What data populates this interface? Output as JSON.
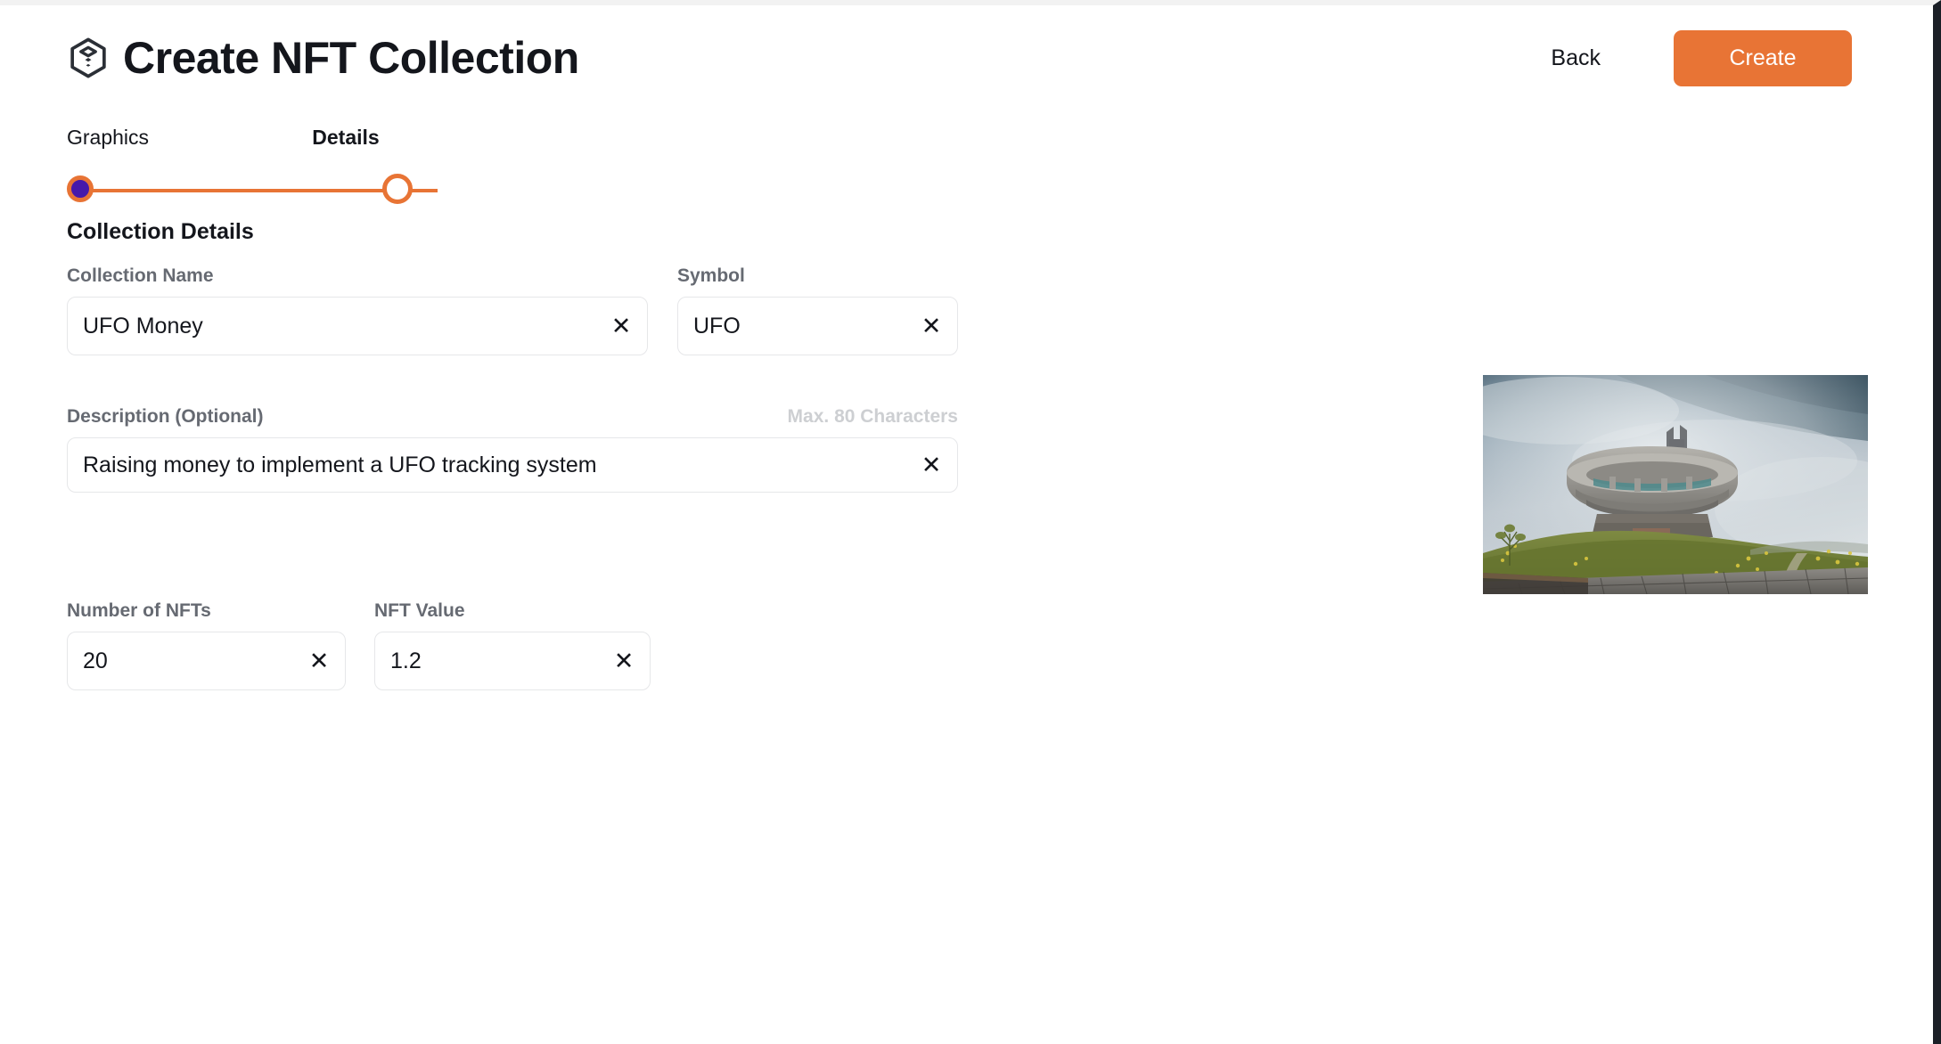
{
  "header": {
    "title": "Create NFT Collection",
    "brand_icon": "cube-hexagon-icon",
    "back_label": "Back",
    "create_label": "Create"
  },
  "stepper": {
    "steps": [
      {
        "label": "Graphics",
        "state": "completed"
      },
      {
        "label": "Details",
        "state": "current"
      }
    ],
    "accent_color": "#e87435",
    "completed_dot_color": "#4619ab"
  },
  "section": {
    "title": "Collection Details"
  },
  "fields": {
    "collection_name": {
      "label": "Collection Name",
      "value": "UFO Money",
      "placeholder": "",
      "clear_icon": "close-icon"
    },
    "symbol": {
      "label": "Symbol",
      "value": "UFO",
      "placeholder": "",
      "clear_icon": "close-icon"
    },
    "description": {
      "label": "Description (Optional)",
      "hint": "Max. 80 Characters",
      "value": "Raising money to implement a UFO tracking system",
      "placeholder": "",
      "clear_icon": "close-icon"
    },
    "number_of_nfts": {
      "label": "Number of NFTs",
      "value": "20",
      "placeholder": "",
      "clear_icon": "close-icon"
    },
    "nft_value": {
      "label": "NFT Value",
      "value": "1.2",
      "placeholder": "",
      "clear_icon": "close-icon"
    }
  },
  "preview": {
    "alt": "Buzludzha UFO-shaped concrete monument on a grassy hill under a cloudy sky"
  }
}
